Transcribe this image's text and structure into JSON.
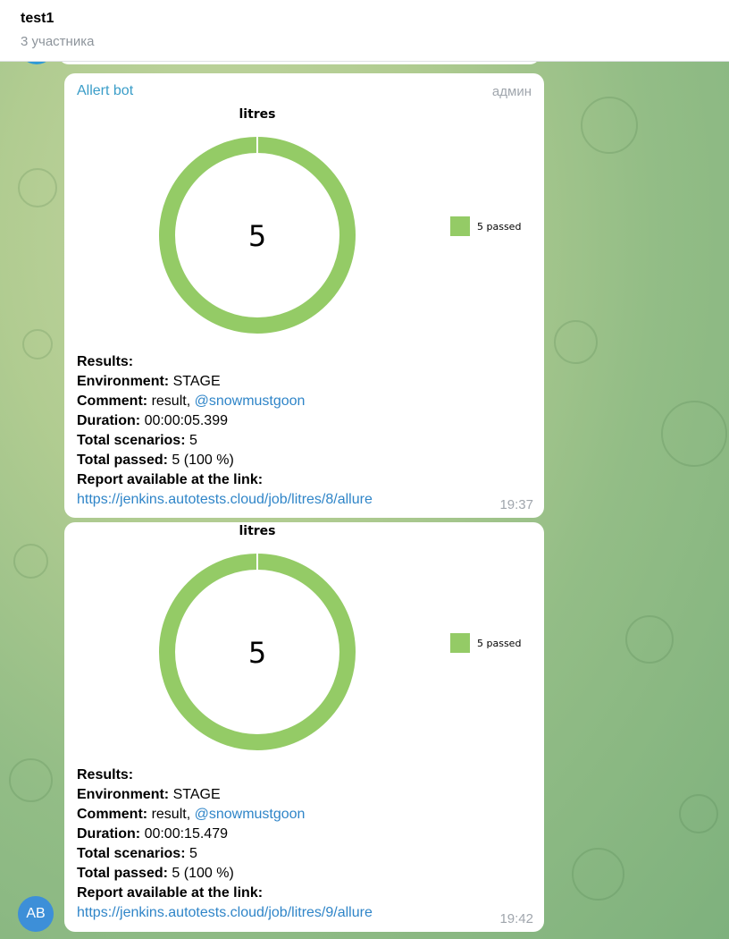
{
  "header": {
    "title": "test1",
    "subtitle": "3 участника"
  },
  "messages": [
    {
      "sender": "Allert bot",
      "role": "админ",
      "chart_data": {
        "type": "pie",
        "title": "litres",
        "center_label": "5",
        "categories": [
          "5 passed"
        ],
        "values": [
          5
        ],
        "colors": [
          "#94cb66"
        ]
      },
      "results_label": "Results:",
      "environment_label": "Environment:",
      "environment": "STAGE",
      "comment_label": "Comment:",
      "comment": "result,",
      "mention": "@snowmustgoon",
      "duration_label": "Duration:",
      "duration": "00:00:05.399",
      "total_scenarios_label": "Total scenarios:",
      "total_scenarios": "5",
      "total_passed_label": "Total passed:",
      "total_passed": "5 (100 %)",
      "report_label": "Report available at the link:",
      "link": "https://jenkins.autotests.cloud/job/litres/8/allure",
      "time": "19:37"
    },
    {
      "chart_data": {
        "type": "pie",
        "title": "litres",
        "center_label": "5",
        "categories": [
          "5 passed"
        ],
        "values": [
          5
        ],
        "colors": [
          "#94cb66"
        ]
      },
      "results_label": "Results:",
      "environment_label": "Environment:",
      "environment": "STAGE",
      "comment_label": "Comment:",
      "comment": "result,",
      "mention": "@snowmustgoon",
      "duration_label": "Duration:",
      "duration": "00:00:15.479",
      "total_scenarios_label": "Total scenarios:",
      "total_scenarios": "5",
      "total_passed_label": "Total passed:",
      "total_passed": "5 (100 %)",
      "report_label": "Report available at the link:",
      "link": "https://jenkins.autotests.cloud/job/litres/9/allure",
      "time": "19:42"
    }
  ],
  "avatar": {
    "initials": "AB",
    "color": "#3d8fd8"
  }
}
